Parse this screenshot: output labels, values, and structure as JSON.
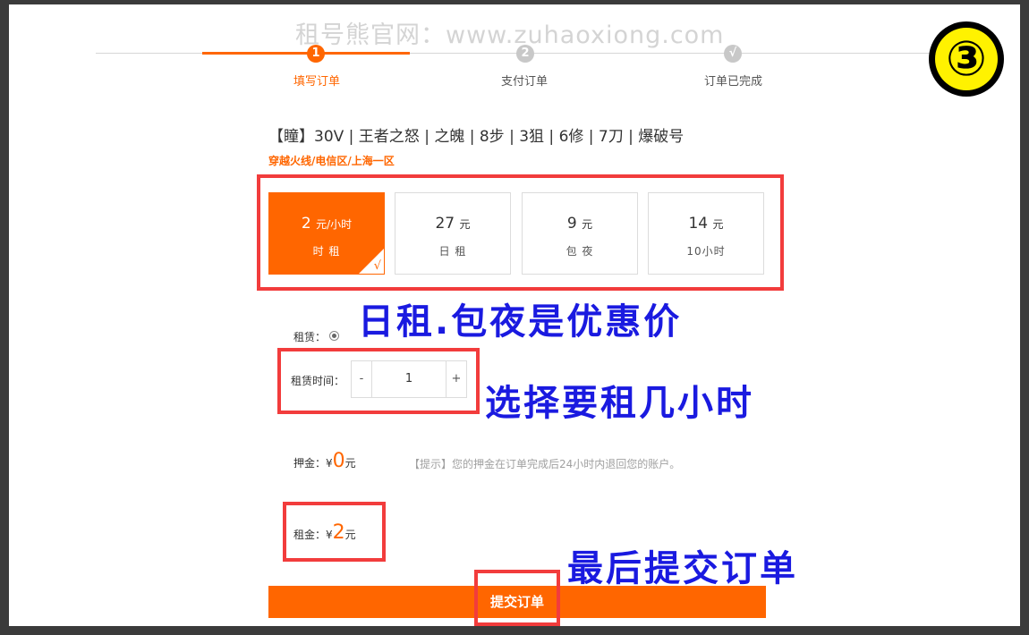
{
  "watermark": "租号熊官网：www.zuhaoxiong.com",
  "steps": [
    {
      "number": "1",
      "label": "填写订单"
    },
    {
      "number": "2",
      "label": "支付订单"
    },
    {
      "number": "√",
      "label": "订单已完成"
    }
  ],
  "badge": "③",
  "product": {
    "title": "【瞳】30V | 王者之怒 | 之魄 | 8步 | 3狙 | 6修 | 7刀 | 爆破号",
    "region": "穿越火线/电信区/上海一区"
  },
  "price_options": [
    {
      "price": "2",
      "currency": "元/小时",
      "unit": "时 租",
      "selected": true
    },
    {
      "price": "27",
      "currency": "元",
      "unit": "日 租",
      "selected": false
    },
    {
      "price": "9",
      "currency": "元",
      "unit": "包 夜",
      "selected": false
    },
    {
      "price": "14",
      "currency": "元",
      "unit": "10小时",
      "selected": false
    }
  ],
  "check_mark": "√",
  "annotations": {
    "prices": "日租.包夜是优惠价",
    "duration": "选择要租几小时",
    "submit": "最后提交订单"
  },
  "form": {
    "rent_mode_label": "租赁：",
    "duration_label": "租赁时间：",
    "stepper_minus": "-",
    "stepper_value": "1",
    "stepper_plus": "+",
    "deposit_label": "押金：¥",
    "deposit_value": "0",
    "yuan": "元",
    "deposit_hint": "【提示】您的押金在订单完成后24小时内退回您的账户。",
    "rent_label": "租金：¥",
    "rent_value": "2"
  },
  "submit_label": "提交订单",
  "colors": {
    "accent": "#ff6600",
    "annotation_text": "#1a1ae0",
    "annotation_box": "#f23c3c"
  }
}
